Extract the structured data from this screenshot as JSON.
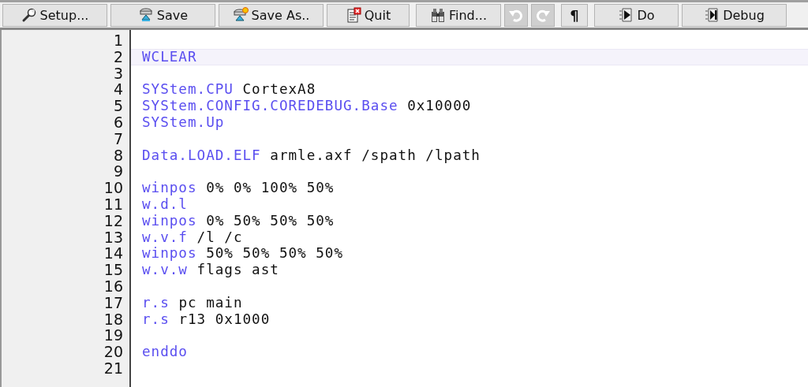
{
  "toolbar": [
    {
      "kind": "setup",
      "label": "Setup...",
      "disabled": false
    },
    {
      "kind": "save",
      "label": "Save",
      "disabled": false
    },
    {
      "kind": "saveas",
      "label": "Save As..",
      "disabled": false
    },
    {
      "kind": "quit",
      "label": "Quit",
      "disabled": false
    },
    {
      "kind": "find",
      "label": "Find...",
      "disabled": false
    },
    {
      "kind": "undo",
      "disabled": true
    },
    {
      "kind": "redo",
      "disabled": true
    },
    {
      "kind": "pilcrow",
      "label": "¶",
      "disabled": false
    },
    {
      "kind": "do",
      "label": "Do",
      "disabled": false
    },
    {
      "kind": "debug",
      "label": "Debug",
      "disabled": false
    }
  ],
  "editor": {
    "lines": [
      {
        "number": "1",
        "current": false
      },
      {
        "number": "2",
        "command": "WCLEAR",
        "current": true
      },
      {
        "number": "3",
        "current": false
      },
      {
        "number": "4",
        "command": "SYStem.CPU",
        "args": "CortexA8",
        "current": false
      },
      {
        "number": "5",
        "command": "SYStem.CONFIG.COREDEBUG.Base",
        "args": "0x10000",
        "current": false
      },
      {
        "number": "6",
        "command": "SYStem.Up",
        "current": false
      },
      {
        "number": "7",
        "current": false
      },
      {
        "number": "8",
        "command": "Data.LOAD.ELF",
        "args": "armle.axf /spath /lpath",
        "current": false
      },
      {
        "number": "9",
        "current": false
      },
      {
        "number": "10",
        "command": "winpos",
        "args": "0% 0% 100% 50%",
        "current": false
      },
      {
        "number": "11",
        "command": "w.d.l",
        "current": false
      },
      {
        "number": "12",
        "command": "winpos",
        "args": "0% 50% 50% 50%",
        "current": false
      },
      {
        "number": "13",
        "command": "w.v.f",
        "args": "/l /c",
        "current": false
      },
      {
        "number": "14",
        "command": "winpos",
        "args": "50% 50% 50% 50%",
        "current": false
      },
      {
        "number": "15",
        "command": "w.v.w",
        "args": "flags ast",
        "current": false
      },
      {
        "number": "16",
        "current": false
      },
      {
        "number": "17",
        "command": "r.s",
        "args": "pc main",
        "current": false
      },
      {
        "number": "18",
        "command": "r.s",
        "args": "r13 0x1000",
        "current": false
      },
      {
        "number": "19",
        "current": false
      },
      {
        "number": "20",
        "command": "enddo",
        "current": false
      },
      {
        "number": "21",
        "current": false
      }
    ]
  }
}
